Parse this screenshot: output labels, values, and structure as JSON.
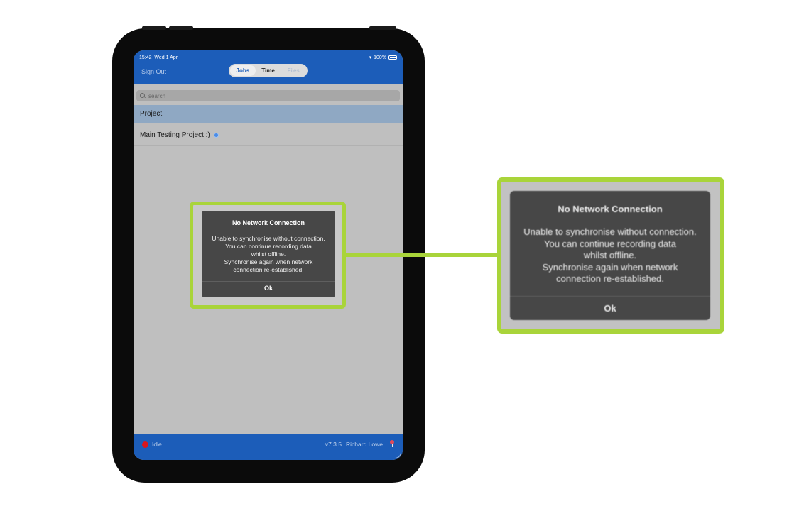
{
  "status_bar": {
    "time": "15:42",
    "date": "Wed 1 Apr",
    "battery": "100%"
  },
  "header": {
    "sign_out": "Sign Out",
    "tabs": [
      {
        "label": "Jobs",
        "state": "active"
      },
      {
        "label": "Time",
        "state": "normal"
      },
      {
        "label": "Files",
        "state": "disabled"
      }
    ]
  },
  "search": {
    "placeholder": "search",
    "value": ""
  },
  "list": {
    "section_header": "Project",
    "items": [
      {
        "label": "Main Testing Project :)"
      }
    ]
  },
  "alert": {
    "title": "No Network Connection",
    "lines": [
      "Unable to synchronise without connection.",
      "You can continue recording data",
      "whilst offline.",
      "Synchronise again when network",
      "connection re-established."
    ],
    "ok_label": "Ok"
  },
  "footer": {
    "status": "Idle",
    "version": "v7.3.5",
    "user": "Richard Lowe"
  },
  "colors": {
    "brand_blue": "#1c5db9",
    "highlight_green": "#a9d43a",
    "idle_red": "#d9161d",
    "alert_bg": "#474747"
  }
}
